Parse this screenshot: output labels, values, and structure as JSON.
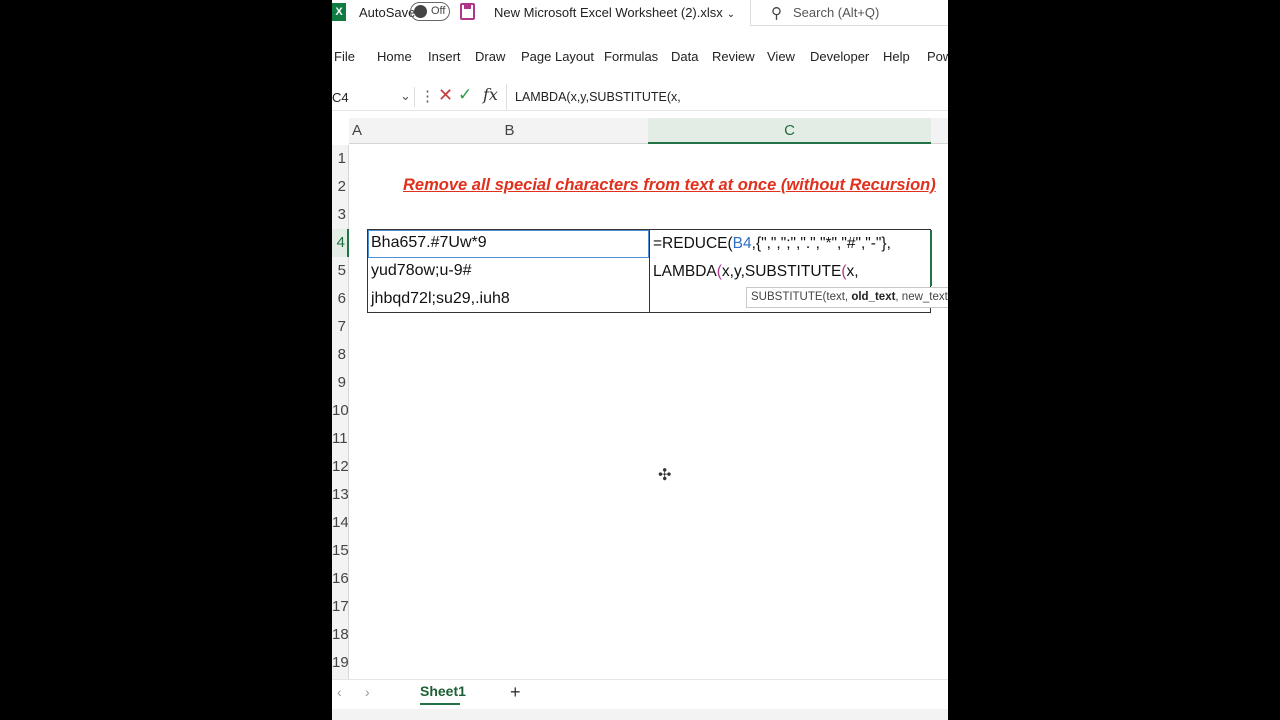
{
  "titlebar": {
    "app_icon": "excel-icon",
    "autosave_label": "AutoSave",
    "autosave_state": "Off",
    "filename": "New Microsoft Excel Worksheet (2).xlsx",
    "search_placeholder": "Search (Alt+Q)"
  },
  "ribbon": {
    "tabs": [
      "File",
      "Home",
      "Insert",
      "Draw",
      "Page Layout",
      "Formulas",
      "Data",
      "Review",
      "View",
      "Developer",
      "Help",
      "Pow"
    ]
  },
  "formula_bar": {
    "name_box": "C4",
    "fx_label": "fx",
    "value": "LAMBDA(x,y,SUBSTITUTE(x,"
  },
  "sheet": {
    "columns": [
      "A",
      "B",
      "C"
    ],
    "active_column": "C",
    "rows": [
      "1",
      "2",
      "3",
      "4",
      "5",
      "6",
      "7",
      "8",
      "9",
      "10",
      "11",
      "12",
      "13",
      "14",
      "15",
      "16",
      "17",
      "18",
      "19"
    ],
    "active_row": "4",
    "title": "Remove all special characters from text at once (without Recursion)",
    "b_cells": [
      "Bha657.#7Uw*9",
      "yud78ow;u-9#",
      "jhbqd72l;su29,.iuh8"
    ],
    "edit_line1_prefix": "=REDUCE(",
    "edit_line1_ref": "B4",
    "edit_line1_rest": ",{\",\",\";\",\".\",\"*\",\"#\",\"-\"},",
    "edit_line2_fn": "LAMBDA",
    "edit_line2_args": "x,y,SUBSTITUTE",
    "edit_line2_tail": "x,",
    "tooltip_prefix": "SUBSTITUTE(text, ",
    "tooltip_bold": "old_text",
    "tooltip_suffix": ", new_text, [inst"
  },
  "sheet_tabs": {
    "active": "Sheet1"
  },
  "colors": {
    "excel_green": "#217346",
    "title_red": "#e0301e",
    "ref_blue": "#2f6fc4"
  }
}
